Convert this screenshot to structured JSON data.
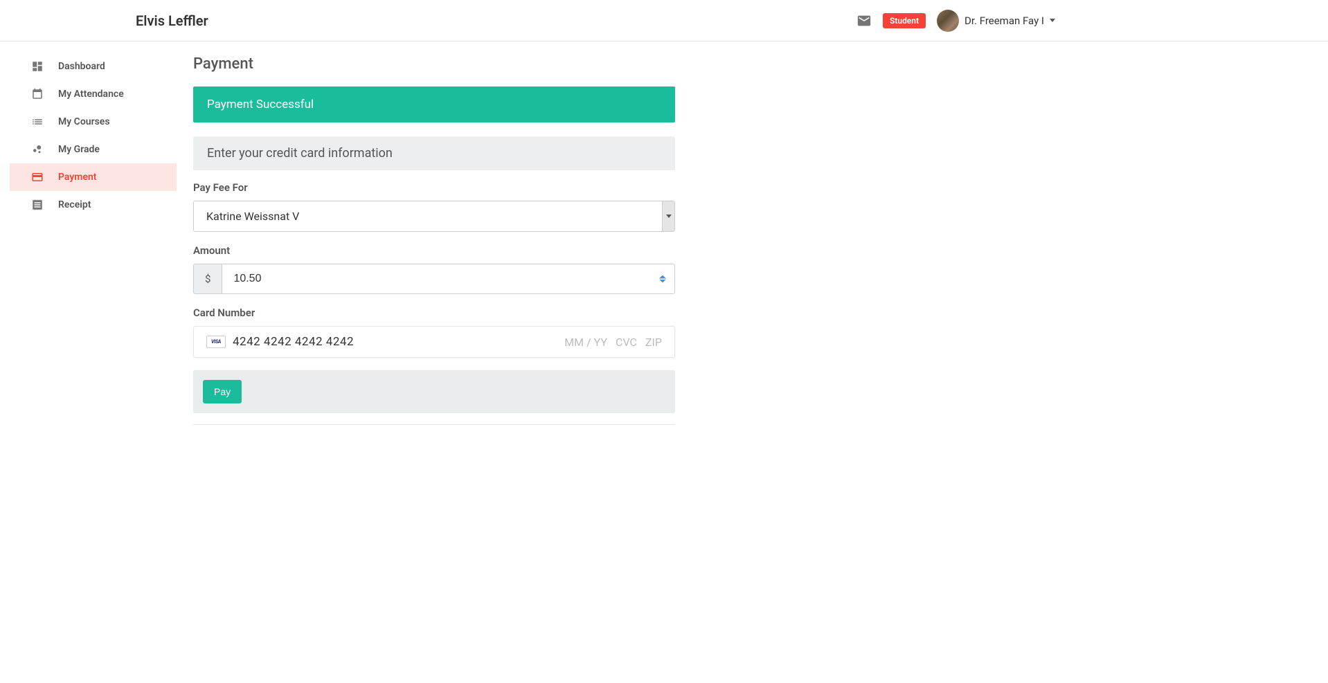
{
  "header": {
    "app_title": "Elvis Leffler",
    "role_badge": "Student",
    "user_name": "Dr. Freeman Fay I"
  },
  "sidebar": {
    "items": [
      {
        "label": "Dashboard",
        "icon": "dashboard",
        "active": false
      },
      {
        "label": "My Attendance",
        "icon": "calendar",
        "active": false
      },
      {
        "label": "My Courses",
        "icon": "list",
        "active": false
      },
      {
        "label": "My Grade",
        "icon": "bubble-chart",
        "active": false
      },
      {
        "label": "Payment",
        "icon": "credit-card",
        "active": true
      },
      {
        "label": "Receipt",
        "icon": "receipt",
        "active": false
      }
    ]
  },
  "main": {
    "page_title": "Payment",
    "success_message": "Payment Successful",
    "form": {
      "section_title": "Enter your credit card information",
      "pay_fee_for": {
        "label": "Pay Fee For",
        "value": "Katrine Weissnat V"
      },
      "amount": {
        "label": "Amount",
        "currency_symbol": "$",
        "value": "10.50"
      },
      "card_number": {
        "label": "Card Number",
        "brand": "VISA",
        "value": "4242 4242 4242 4242",
        "expiry_placeholder": "MM / YY",
        "cvc_placeholder": "CVC",
        "zip_placeholder": "ZIP"
      },
      "pay_button": "Pay"
    }
  }
}
